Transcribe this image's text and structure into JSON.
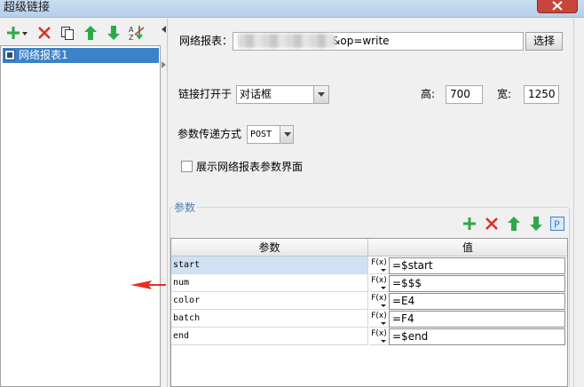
{
  "window": {
    "title": "超级链接"
  },
  "left_toolbar": {
    "icons": [
      "add-dropdown-icon",
      "delete-icon",
      "copy-icon",
      "move-up-icon",
      "move-down-icon",
      "sort-az-icon"
    ]
  },
  "tree": {
    "items": [
      {
        "label": "网络报表1",
        "selected": true
      }
    ]
  },
  "report": {
    "label": "网络报表：",
    "url_visible_suffix": "\u001e&op=write",
    "select_button": "选择"
  },
  "open_in": {
    "label": "链接打开于",
    "value": "对话框",
    "height_label": "高:",
    "height_value": "700",
    "width_label": "宽:",
    "width_value": "1250"
  },
  "transfer": {
    "label": "参数传递方式",
    "value": "POST"
  },
  "show_params": {
    "label": "展示网络报表参数界面",
    "checked": false
  },
  "params": {
    "legend": "参数",
    "header_name": "参数",
    "header_value": "值",
    "fx_label": "F(x)",
    "rows": [
      {
        "name": "start",
        "value": "=$start",
        "selected": true
      },
      {
        "name": "num",
        "value": "=$$$",
        "selected": false
      },
      {
        "name": "color",
        "value": "=E4",
        "selected": false
      },
      {
        "name": "batch",
        "value": "=F4",
        "selected": false
      },
      {
        "name": "end",
        "value": "=$end",
        "selected": false
      }
    ]
  },
  "colors": {
    "accent_blue": "#3b82c9",
    "add_green": "#2da84a",
    "delete_red": "#d9302a",
    "annotation_arrow": "#e8301f"
  }
}
